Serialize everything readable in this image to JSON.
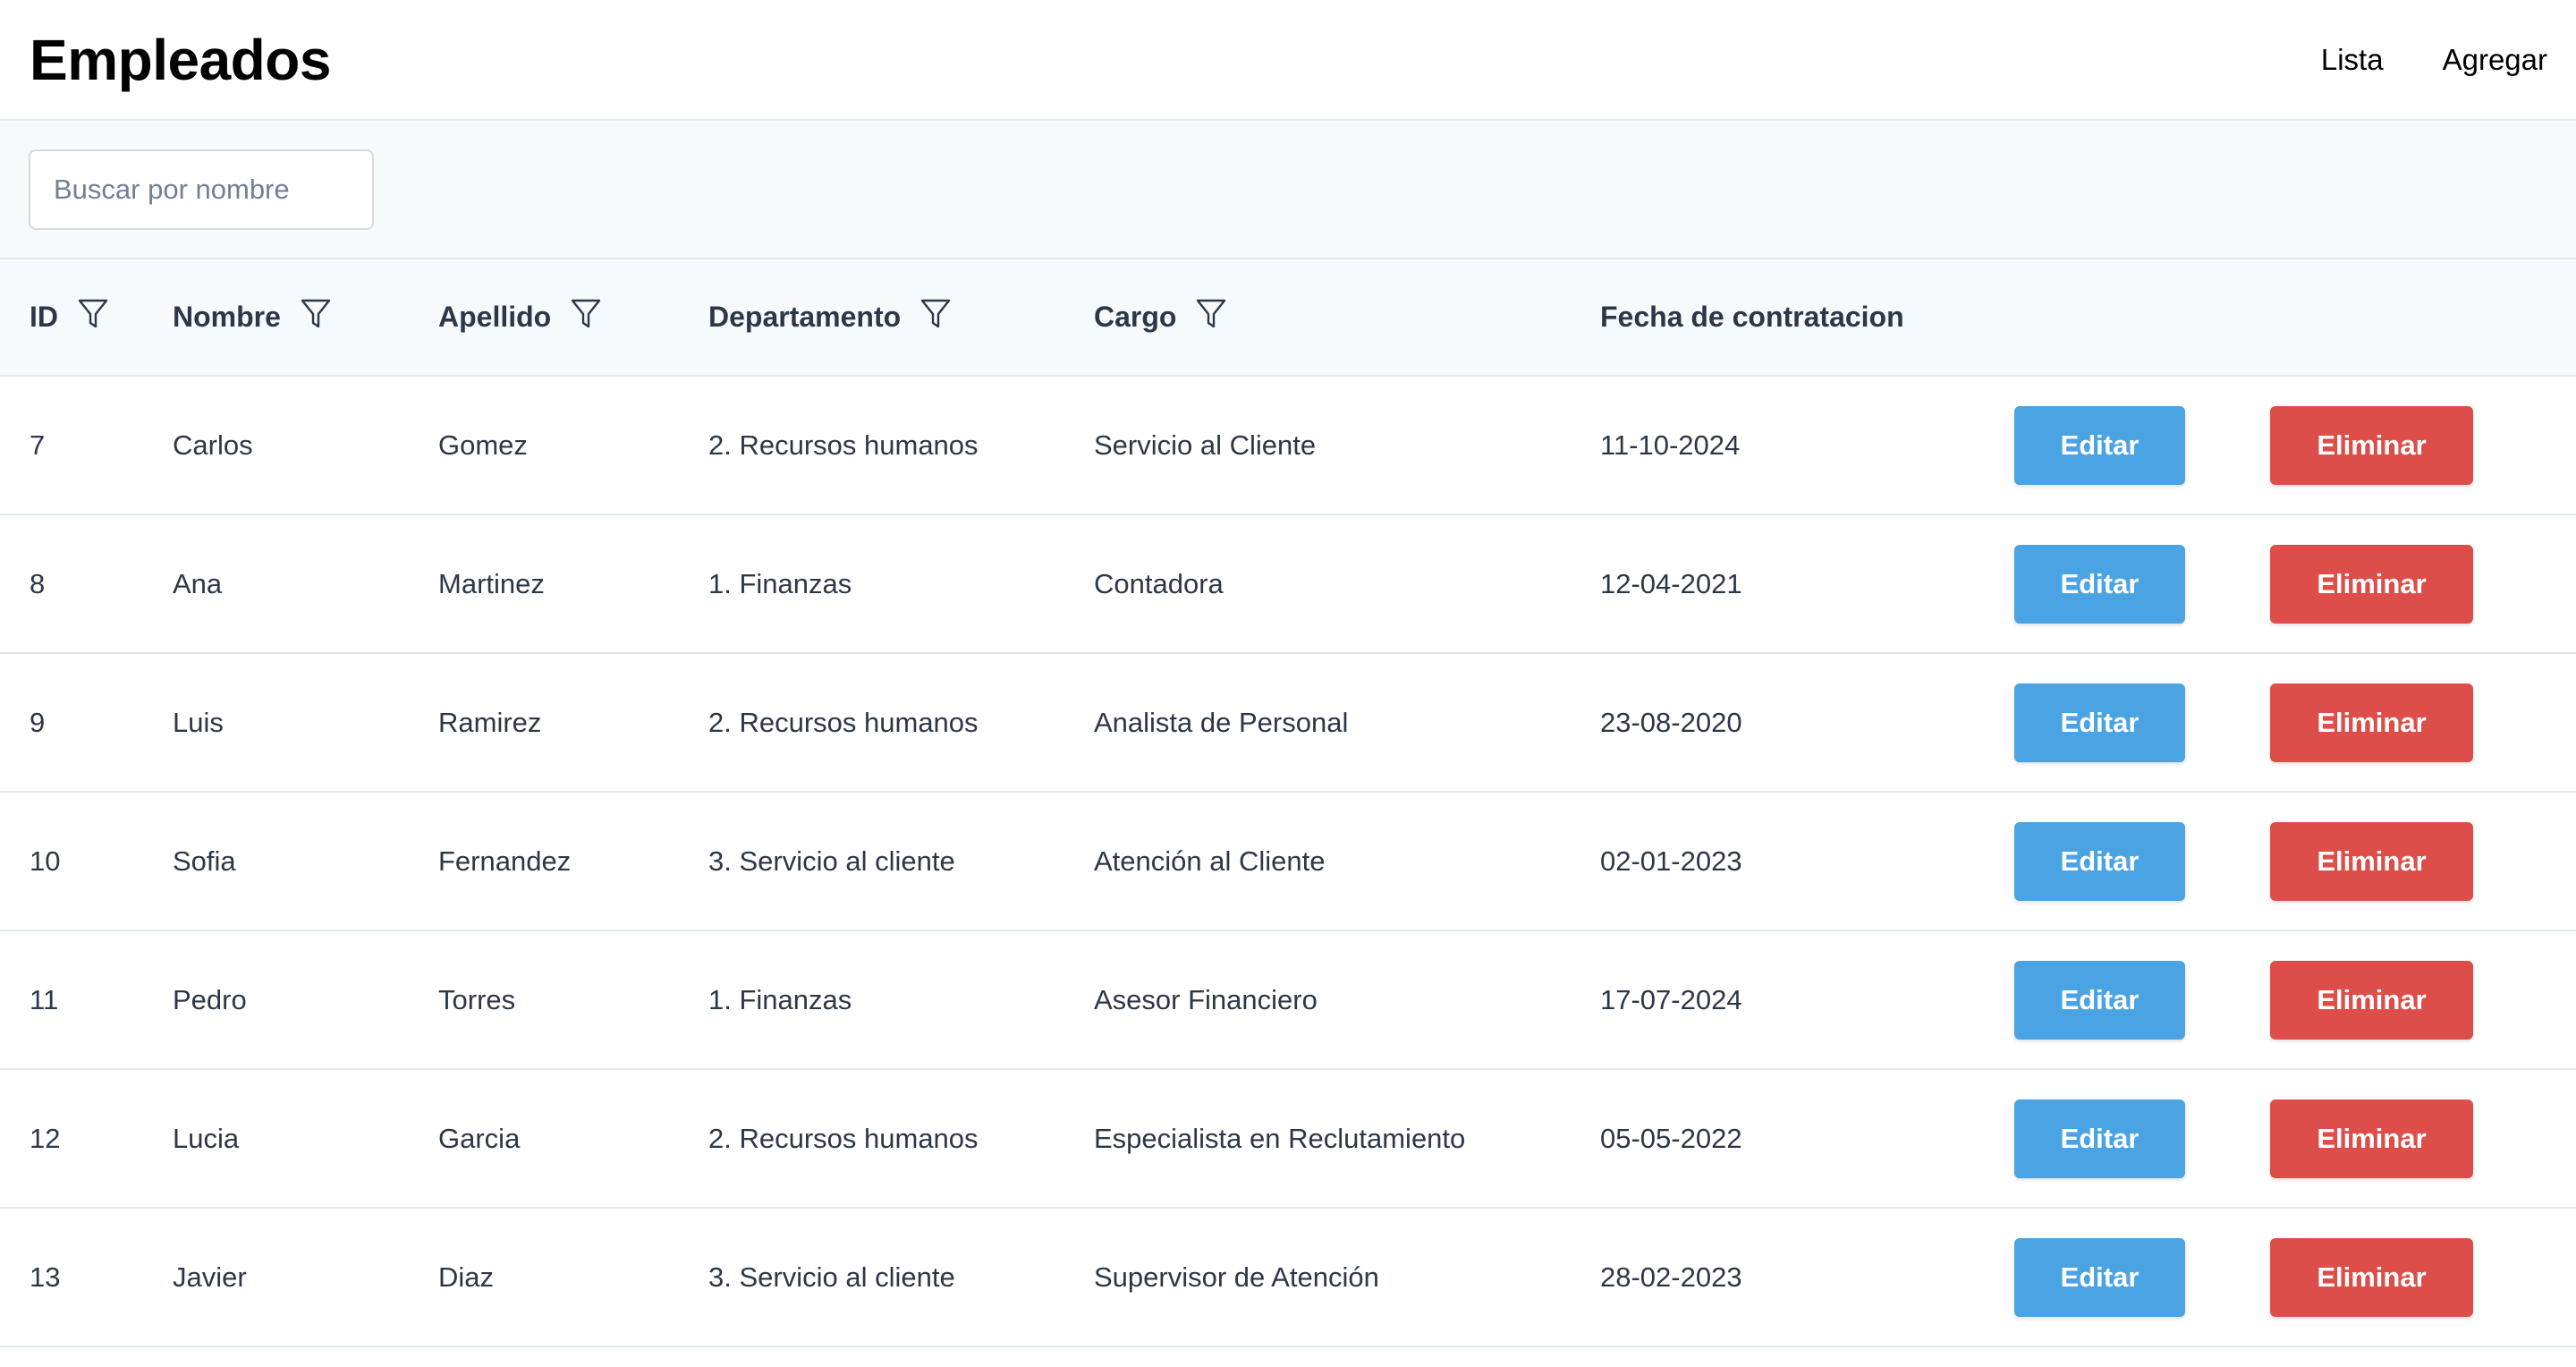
{
  "header": {
    "title": "Empleados",
    "nav": [
      "Lista",
      "Agregar"
    ]
  },
  "search": {
    "placeholder": "Buscar por nombre",
    "value": ""
  },
  "table": {
    "columns": [
      "ID",
      "Nombre",
      "Apellido",
      "Departamento",
      "Cargo",
      "Fecha de contratacion"
    ],
    "filterable": [
      true,
      true,
      true,
      true,
      true,
      false
    ],
    "edit_label": "Editar",
    "delete_label": "Eliminar",
    "rows": [
      {
        "id": "7",
        "nombre": "Carlos",
        "apellido": "Gomez",
        "departamento": "2. Recursos humanos",
        "cargo": "Servicio al Cliente",
        "fecha": "11-10-2024"
      },
      {
        "id": "8",
        "nombre": "Ana",
        "apellido": "Martinez",
        "departamento": "1. Finanzas",
        "cargo": "Contadora",
        "fecha": "12-04-2021"
      },
      {
        "id": "9",
        "nombre": "Luis",
        "apellido": "Ramirez",
        "departamento": "2. Recursos humanos",
        "cargo": "Analista de Personal",
        "fecha": "23-08-2020"
      },
      {
        "id": "10",
        "nombre": "Sofia",
        "apellido": "Fernandez",
        "departamento": "3. Servicio al cliente",
        "cargo": "Atención al Cliente",
        "fecha": "02-01-2023"
      },
      {
        "id": "11",
        "nombre": "Pedro",
        "apellido": "Torres",
        "departamento": "1. Finanzas",
        "cargo": "Asesor Financiero",
        "fecha": "17-07-2024"
      },
      {
        "id": "12",
        "nombre": "Lucia",
        "apellido": "Garcia",
        "departamento": "2. Recursos humanos",
        "cargo": "Especialista en Reclutamiento",
        "fecha": "05-05-2022"
      },
      {
        "id": "13",
        "nombre": "Javier",
        "apellido": "Diaz",
        "departamento": "3. Servicio al cliente",
        "cargo": "Supervisor de Atención",
        "fecha": "28-02-2023"
      }
    ]
  },
  "colors": {
    "edit": "#4aa3e2",
    "delete": "#dd4d4a",
    "header_bg": "#f7fafc",
    "border": "#e2e8f0"
  },
  "icons": {
    "filter": "filter-icon"
  }
}
